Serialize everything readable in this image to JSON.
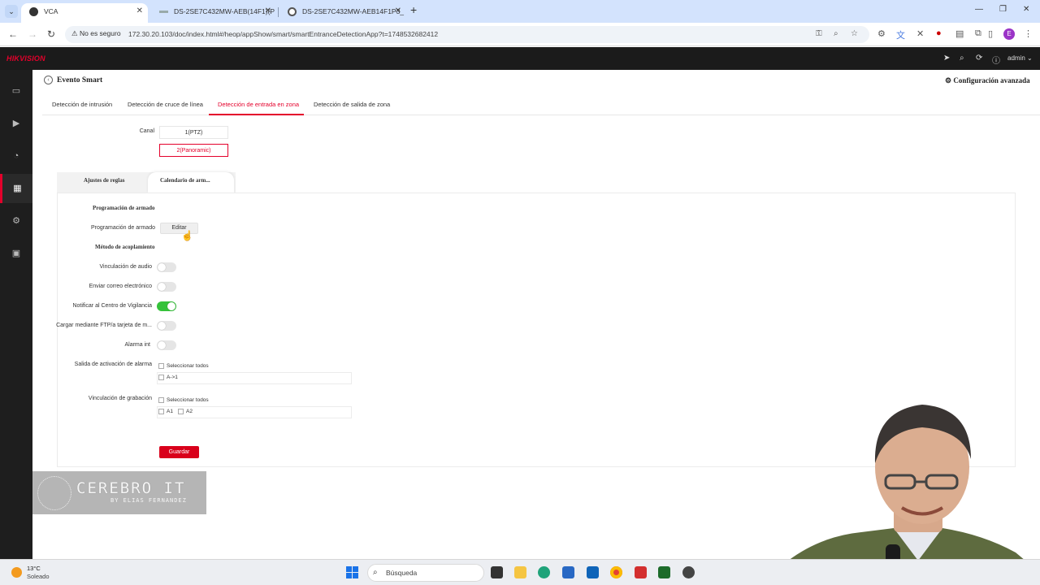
{
  "browser": {
    "tabs": [
      {
        "title": "VCA",
        "active": true
      },
      {
        "title": "DS-2SE7C432MW-AEB(14F1)(P",
        "active": false
      },
      {
        "title": "DS-2SE7C432MW-AEB14F1P3_",
        "active": false
      }
    ],
    "security_label": "No es seguro",
    "url": "172.30.20.103/doc/index.html#/heop/appShow/smart/smartEntranceDetectionApp?t=1748532682412",
    "profile_initial": "E"
  },
  "app": {
    "brand": "HIKVISION",
    "user": "admin",
    "page_title": "Evento Smart",
    "advanced_config": "Configuración avanzada",
    "function_tabs": [
      "Detección de intrusión",
      "Detección de cruce de línea",
      "Detección de entrada en zona",
      "Detección de salida de zona"
    ],
    "channel_label": "Canal",
    "channels": [
      "1(PTZ)",
      "2(Panoramic)"
    ],
    "sub_tabs": [
      "Ajustes de reglas",
      "Calendario de arm..."
    ],
    "schedule_heading": "Programación de armado",
    "schedule_label": "Programación de armado",
    "edit_button": "Editar",
    "linkage_heading": "Método de acoplamiento",
    "linkages": [
      {
        "label": "Vinculación de audio",
        "on": false
      },
      {
        "label": "Enviar correo electrónico",
        "on": false
      },
      {
        "label": "Notificar al Centro de Vigilancia",
        "on": true
      },
      {
        "label": "Cargar mediante FTP/a tarjeta de m...",
        "on": false
      },
      {
        "label": "Alarma int",
        "on": false
      }
    ],
    "alarm_output_label": "Salida de activación de alarma",
    "select_all": "Seleccionar todos",
    "alarm_outputs": [
      "A->1"
    ],
    "record_label": "Vinculación de grabación",
    "record_channels": [
      "A1",
      "A2"
    ],
    "save_button": "Guardar"
  },
  "watermark": {
    "title": "CEREBRO IT",
    "subtitle": "BY ELIAS FERNANDEZ"
  },
  "taskbar": {
    "temperature": "13°C",
    "weather": "Soleado",
    "search_placeholder": "Búsqueda"
  },
  "colors": {
    "accent": "#e4002b",
    "toggle_on": "#35c23a",
    "save": "#d9001b"
  }
}
